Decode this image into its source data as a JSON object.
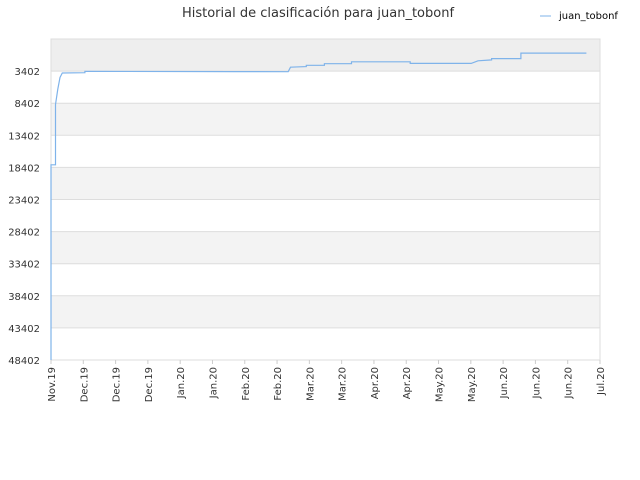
{
  "chart_data": {
    "type": "line",
    "title": "Historial de clasificación para juan_tobonf",
    "xlabel": "",
    "ylabel": "",
    "y_inverted": true,
    "ylim": [
      48402,
      -1600
    ],
    "y_ticks": [
      3402,
      8402,
      13402,
      18402,
      23402,
      28402,
      33402,
      38402,
      43402,
      48402
    ],
    "x_ticks": [
      "Nov.19",
      "Dec.19",
      "Dec.19",
      "Dec.19",
      "Jan.20",
      "Jan.20",
      "Feb.20",
      "Feb.20",
      "Mar.20",
      "Mar.20",
      "Apr.20",
      "Apr.20",
      "May.20",
      "May.20",
      "Jun.20",
      "Jun.20",
      "Jun.20",
      "Jul.20"
    ],
    "xlim": [
      "2019-11-01",
      "2020-07-01"
    ],
    "grid": true,
    "legend_position": "top-right",
    "line_color": "#7fb3ea",
    "series": [
      {
        "name": "juan_tobonf",
        "points": [
          [
            "2019-11-01",
            48402
          ],
          [
            "2019-11-01",
            18000
          ],
          [
            "2019-11-03",
            18000
          ],
          [
            "2019-11-03",
            8600
          ],
          [
            "2019-11-04",
            6200
          ],
          [
            "2019-11-05",
            4400
          ],
          [
            "2019-11-06",
            3700
          ],
          [
            "2019-11-16",
            3650
          ],
          [
            "2019-11-16",
            3450
          ],
          [
            "2020-01-21",
            3480
          ],
          [
            "2020-02-14",
            3500
          ],
          [
            "2020-02-15",
            2800
          ],
          [
            "2020-02-22",
            2700
          ],
          [
            "2020-02-22",
            2500
          ],
          [
            "2020-03-01",
            2500
          ],
          [
            "2020-03-01",
            2250
          ],
          [
            "2020-03-13",
            2250
          ],
          [
            "2020-03-13",
            1950
          ],
          [
            "2020-04-08",
            1950
          ],
          [
            "2020-04-08",
            2200
          ],
          [
            "2020-05-05",
            2200
          ],
          [
            "2020-05-08",
            1800
          ],
          [
            "2020-05-14",
            1650
          ],
          [
            "2020-05-14",
            1450
          ],
          [
            "2020-05-27",
            1450
          ],
          [
            "2020-05-27",
            600
          ],
          [
            "2020-06-25",
            600
          ]
        ]
      }
    ]
  }
}
